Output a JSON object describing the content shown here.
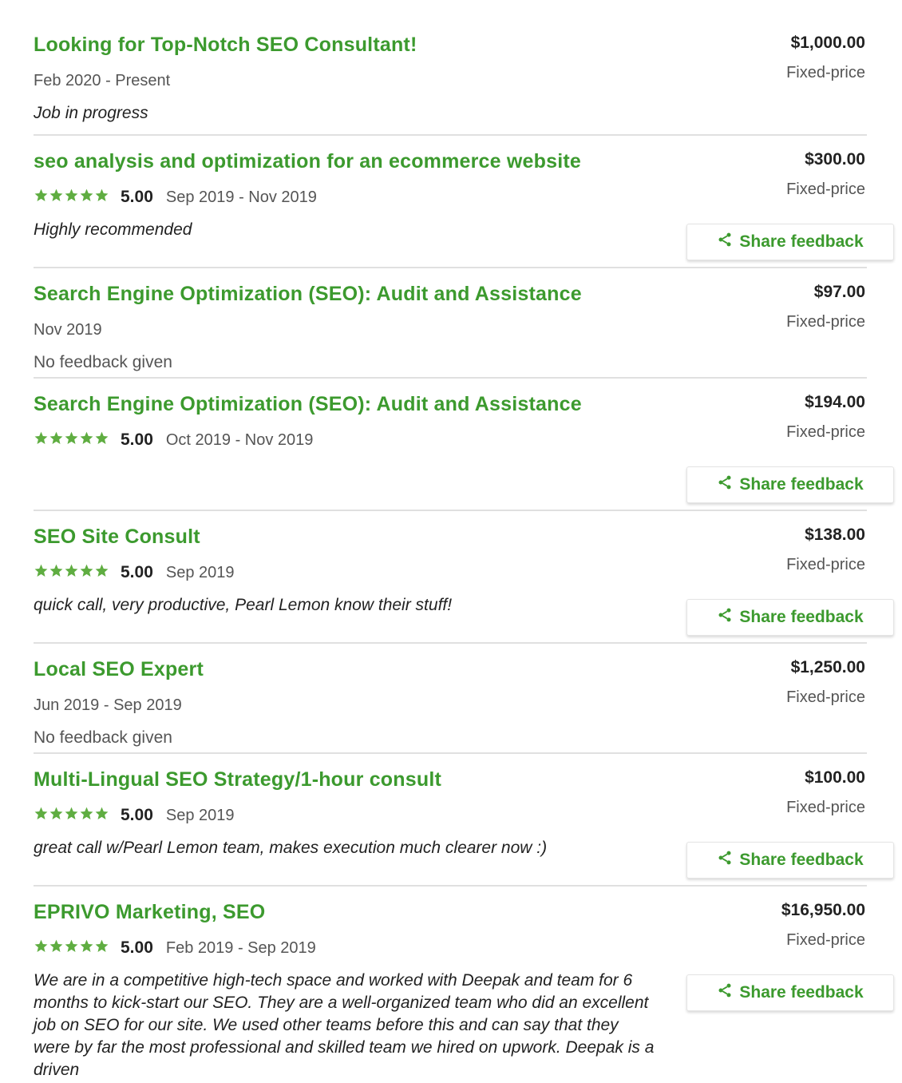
{
  "colors": {
    "accent": "#3c9a2e",
    "text": "#222222",
    "muted": "#555555",
    "divider": "#e0e0e0"
  },
  "icons": {
    "star": "star-icon",
    "share": "share-icon"
  },
  "share_label": "Share feedback",
  "jobs": [
    {
      "title": "Looking for Top-Notch SEO Consultant!",
      "rating": null,
      "dates": "Feb 2020 - Present",
      "comment": "Job in progress",
      "comment_style": "italic",
      "amount": "$1,000.00",
      "price_type": "Fixed-price",
      "share": false
    },
    {
      "title": "seo analysis and optimization for an ecommerce website",
      "rating": "5.00",
      "stars": 5,
      "dates": "Sep 2019 - Nov 2019",
      "comment": "Highly recommended",
      "comment_style": "italic",
      "amount": "$300.00",
      "price_type": "Fixed-price",
      "share": true
    },
    {
      "title": "Search Engine Optimization (SEO): Audit and Assistance",
      "rating": null,
      "dates": "Nov 2019",
      "comment": "No feedback given",
      "comment_style": "muted",
      "amount": "$97.00",
      "price_type": "Fixed-price",
      "share": false
    },
    {
      "title": "Search Engine Optimization (SEO): Audit and Assistance",
      "rating": "5.00",
      "stars": 5,
      "dates": "Oct 2019 - Nov 2019",
      "comment": "",
      "comment_style": "italic",
      "amount": "$194.00",
      "price_type": "Fixed-price",
      "share": true
    },
    {
      "title": "SEO Site Consult",
      "rating": "5.00",
      "stars": 5,
      "dates": "Sep 2019",
      "comment": "quick call, very productive, Pearl Lemon know their stuff!",
      "comment_style": "italic",
      "amount": "$138.00",
      "price_type": "Fixed-price",
      "share": true
    },
    {
      "title": "Local SEO Expert",
      "rating": null,
      "dates": "Jun 2019 - Sep 2019",
      "comment": "No feedback given",
      "comment_style": "muted",
      "amount": "$1,250.00",
      "price_type": "Fixed-price",
      "share": false
    },
    {
      "title": "Multi-Lingual SEO Strategy/1-hour consult",
      "rating": "5.00",
      "stars": 5,
      "dates": "Sep 2019",
      "comment": "great call w/Pearl Lemon team, makes execution much clearer now :)",
      "comment_style": "italic",
      "amount": "$100.00",
      "price_type": "Fixed-price",
      "share": true
    },
    {
      "title": "EPRIVO Marketing, SEO",
      "rating": "5.00",
      "stars": 5,
      "dates": "Feb 2019 - Sep 2019",
      "comment": "We are in a competitive high-tech space and worked with Deepak and team for 6 months to kick-start our SEO. They are a well-organized team who did an excellent job on SEO for our site. We used other teams before this and can say that they were by far the most professional and skilled team we hired on upwork. Deepak is a driven",
      "comment_style": "italic",
      "amount": "$16,950.00",
      "price_type": "Fixed-price",
      "share": true
    }
  ]
}
